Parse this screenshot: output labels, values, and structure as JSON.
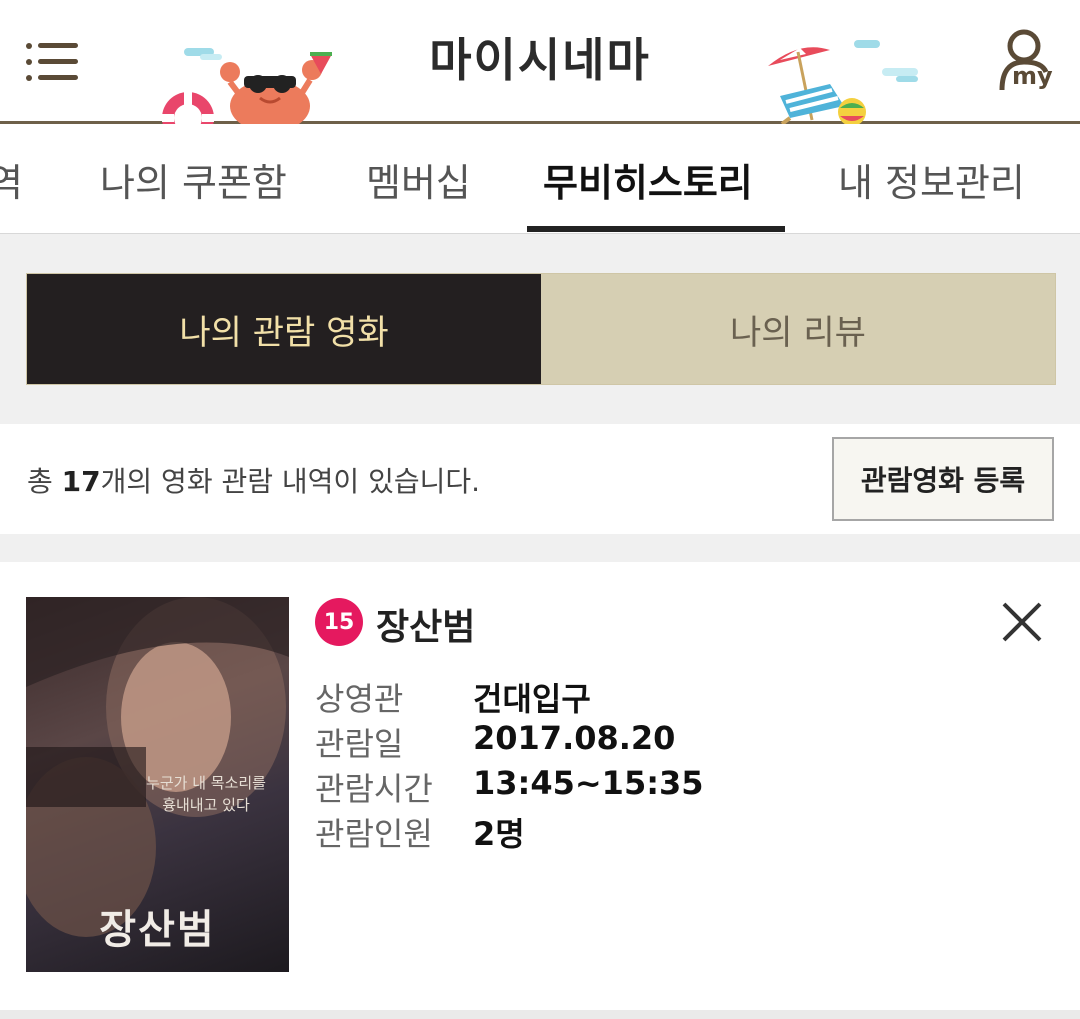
{
  "header": {
    "title": "마이시네마",
    "menu_icon": "hamburger-menu-icon",
    "my_label": "my"
  },
  "tabs": [
    {
      "label": "역"
    },
    {
      "label": "나의 쿠폰함"
    },
    {
      "label": "멤버십"
    },
    {
      "label": "무비히스토리"
    },
    {
      "label": "내 정보관리"
    }
  ],
  "segment": {
    "left_label": "나의 관람 영화",
    "right_label": "나의 리뷰"
  },
  "summary": {
    "prefix": "총 ",
    "count": "17",
    "suffix": "개의 영화 관람 내역이 있습니다.",
    "register_label": "관람영화 등록"
  },
  "movie": {
    "rating": "15",
    "title": "장산범",
    "poster_title": "장산범",
    "poster_tagline": "누군가 내 목소리를 흉내내고 있다",
    "fields": [
      {
        "label": "상영관",
        "value": "건대입구"
      },
      {
        "label": "관람일",
        "value": "2017.08.20"
      },
      {
        "label": "관람시간",
        "value": "13:45~15:35"
      },
      {
        "label": "관람인원",
        "value": "2명"
      }
    ]
  },
  "colors": {
    "header_border": "#6e6049",
    "active_segment_bg": "#231f20",
    "active_segment_text": "#f2e0a8",
    "inactive_segment_bg": "#d6cfb3",
    "rating_badge": "#e5195f"
  }
}
